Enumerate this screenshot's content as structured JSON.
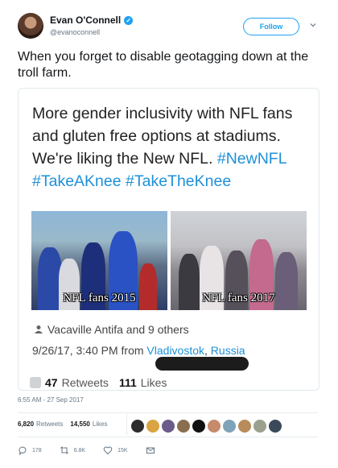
{
  "user": {
    "name": "Evan O'Connell",
    "handle": "@evanoconnell"
  },
  "follow_label": "Follow",
  "tweet_text": "When you forget to disable geotagging down at the troll farm.",
  "embedded": {
    "text": "More gender inclusivity with NFL fans and gluten free options at stadiums. We're liking the New NFL.",
    "hashtags": "#NewNFL #TakeAKnee #TakeTheKnee",
    "photo_captions": [
      "NFL fans 2015",
      "NFL fans 2017"
    ],
    "tagged": "Vacaville Antifa and 9 others",
    "datetime_prefix": "9/26/17, 3:40 PM from",
    "location_city": "Vladivostok",
    "location_country": "Russia",
    "retweets_count": "47",
    "retweets_label": "Retweets",
    "likes_count": "111",
    "likes_label": "Likes"
  },
  "timestamp": "6:55 AM - 27 Sep 2017",
  "stats": {
    "retweets": "6,820",
    "retweets_label": "Retweets",
    "likes": "14,550",
    "likes_label": "Likes"
  },
  "liker_colors": [
    "#2c2c2c",
    "#d9a441",
    "#6b5b8a",
    "#8a6f4e",
    "#111111",
    "#c78a6a",
    "#7fa3b8",
    "#b88b5a",
    "#9aa18c",
    "#3b4a5a"
  ],
  "actions": {
    "replies": "178",
    "retweets": "6.8K",
    "likes": "15K"
  },
  "colors": {
    "accent": "#1da1f2",
    "link": "#1e90d8",
    "muted": "#657786"
  }
}
